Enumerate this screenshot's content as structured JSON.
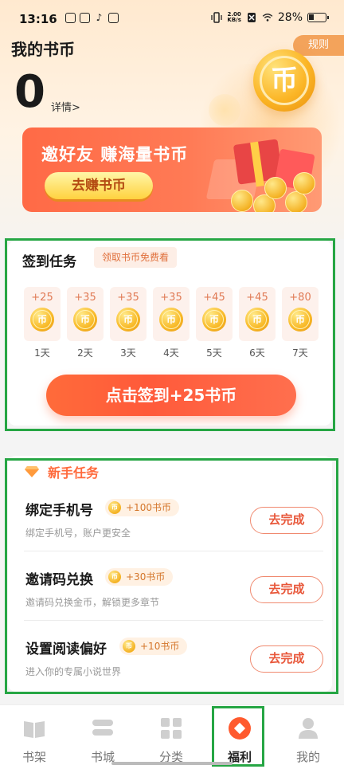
{
  "status_bar": {
    "time": "13:16",
    "net_speed_top": "2.00",
    "net_speed_bottom": "KB/s",
    "battery": "28%",
    "icons": [
      "weibo-icon",
      "mail-icon",
      "tiktok-icon",
      "message-icon",
      "vibrate-icon",
      "sim-off-icon",
      "wifi-icon",
      "battery-icon"
    ]
  },
  "header": {
    "title": "我的书币",
    "rules": "规则",
    "balance": "0",
    "details": "详情>",
    "coin_glyph": "币"
  },
  "invite_banner": {
    "title": "邀好友 赚海量书币",
    "button": "去赚书币"
  },
  "checkin": {
    "title": "签到任务",
    "tag": "领取书币免费看",
    "coin_glyph": "币",
    "days": [
      {
        "bonus": "+25",
        "label": "1天"
      },
      {
        "bonus": "+35",
        "label": "2天"
      },
      {
        "bonus": "+35",
        "label": "3天"
      },
      {
        "bonus": "+35",
        "label": "4天"
      },
      {
        "bonus": "+45",
        "label": "5天"
      },
      {
        "bonus": "+45",
        "label": "6天"
      },
      {
        "bonus": "+80",
        "label": "7天"
      }
    ],
    "button": "点击签到+25书币"
  },
  "newbie_tasks": {
    "title": "新手任务",
    "chip_coin": "币",
    "items": [
      {
        "title": "绑定手机号",
        "reward": "+100书币",
        "desc": "绑定手机号，账户更安全",
        "button": "去完成"
      },
      {
        "title": "邀请码兑换",
        "reward": "+30书币",
        "desc": "邀请码兑换金币，解锁更多章节",
        "button": "去完成"
      },
      {
        "title": "设置阅读偏好",
        "reward": "+10书币",
        "desc": "进入你的专属小说世界",
        "button": "去完成"
      }
    ]
  },
  "bottom_nav": {
    "items": [
      {
        "label": "书架",
        "icon": "bookshelf-icon"
      },
      {
        "label": "书城",
        "icon": "bookstore-icon"
      },
      {
        "label": "分类",
        "icon": "category-icon"
      },
      {
        "label": "福利",
        "icon": "welfare-icon"
      },
      {
        "label": "我的",
        "icon": "profile-icon"
      }
    ],
    "active": "福利"
  },
  "colors": {
    "accent": "#ff6a3c",
    "highlight_frame": "#26a644",
    "coin": "#f8b825"
  }
}
